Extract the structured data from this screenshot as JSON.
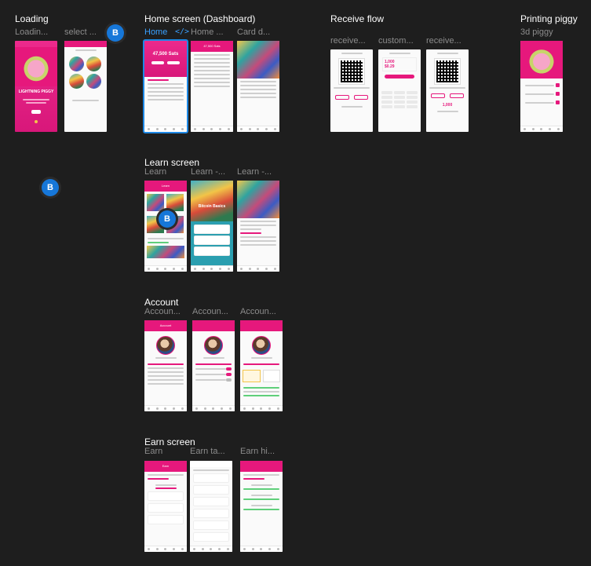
{
  "sections": {
    "loading": {
      "title": "Loading",
      "frames": [
        "Loadin...",
        "select ..."
      ]
    },
    "home": {
      "title": "Home screen (Dashboard)",
      "frames": [
        "Home",
        "Home ...",
        "Card d..."
      ],
      "balance": "47,500 Sats",
      "balance_small": "47,500 Sats"
    },
    "receive": {
      "title": "Receive flow",
      "frames": [
        "receive...",
        "custom...",
        "receive..."
      ],
      "amount": "1,000",
      "fiat": "$0.29",
      "amount2": "1,000"
    },
    "printing": {
      "title": "Printing piggy",
      "frames": [
        "3d piggy"
      ]
    },
    "learn": {
      "title": "Learn screen",
      "frames": [
        "Learn",
        "Learn -...",
        "Learn -..."
      ],
      "header": "Learn",
      "card_title": "Bitcoin Basics"
    },
    "account": {
      "title": "Account",
      "frames": [
        "Accoun...",
        "Accoun...",
        "Accoun..."
      ],
      "header": "Account"
    },
    "earn": {
      "title": "Earn screen",
      "frames": [
        "Earn",
        "Earn ta...",
        "Earn hi..."
      ],
      "header": "Earn"
    }
  },
  "collaborator_badge": "B",
  "loading_logo": "LIGHTNING PIGGY",
  "colors": {
    "canvas": "#1e1e1e",
    "brand_pink": "#e6187c",
    "selection": "#1e88e5",
    "label_gray": "#8c8c8c"
  },
  "icons": {
    "code": "code-icon"
  },
  "code_glyph": "</>"
}
